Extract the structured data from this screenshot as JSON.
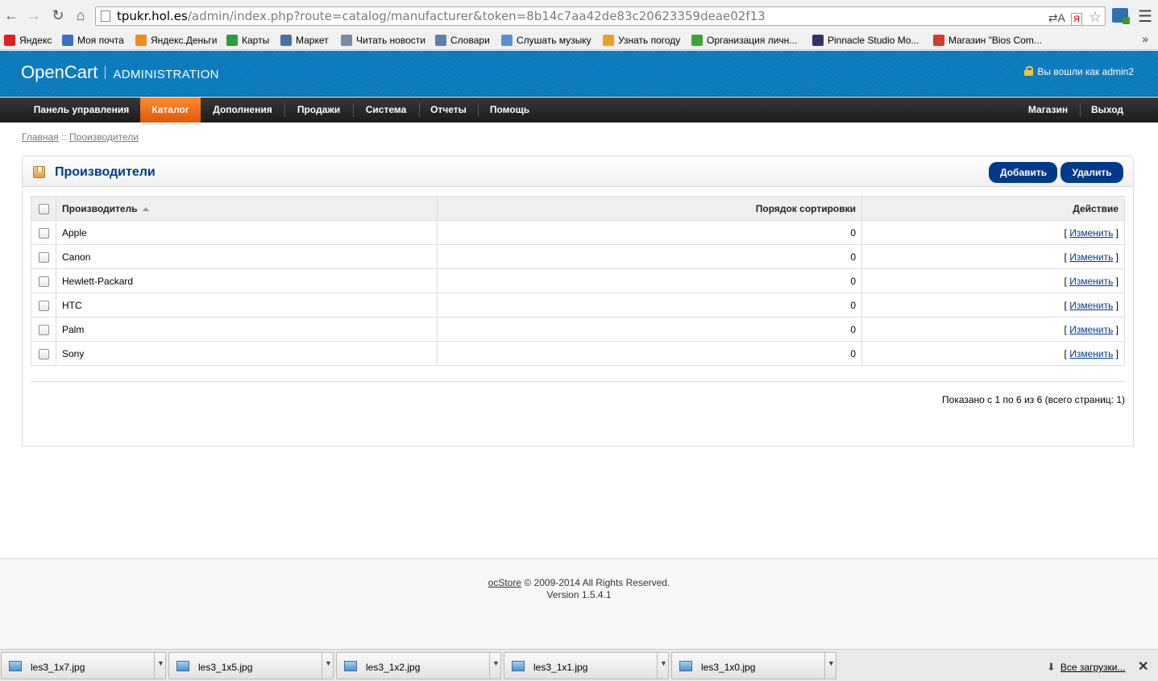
{
  "browser": {
    "url_host": "tpukr.hol.es",
    "url_path": "/admin/index.php?route=catalog/manufacturer&token=8b14c7aa42de83c20623359deae02f13",
    "omni_translate": "⇄A",
    "omni_yandex": "Я",
    "bookmarks": [
      {
        "label": "Яндекс",
        "icon": "yandex-icon",
        "color": "#e02020"
      },
      {
        "label": "Моя почта",
        "icon": "mail-icon",
        "color": "#3a6fc4"
      },
      {
        "label": "Яндекс.Деньги",
        "icon": "money-icon",
        "color": "#f28c1a"
      },
      {
        "label": "Карты",
        "icon": "maps-icon",
        "color": "#2e9d3a"
      },
      {
        "label": "Маркет",
        "icon": "market-icon",
        "color": "#4a6fa5"
      },
      {
        "label": "Читать новости",
        "icon": "news-icon",
        "color": "#7a8aa0"
      },
      {
        "label": "Словари",
        "icon": "dictionary-icon",
        "color": "#5c7fb0"
      },
      {
        "label": "Слушать музыку",
        "icon": "music-icon",
        "color": "#5a8fd0"
      },
      {
        "label": "Узнать погоду",
        "icon": "weather-icon",
        "color": "#f0a020"
      },
      {
        "label": "Организация личн...",
        "icon": "organizer-icon",
        "color": "#3aa53a"
      },
      {
        "label": "Pinnacle Studio Mo...",
        "icon": "pinnacle-icon",
        "color": "#333366"
      },
      {
        "label": "Магазин \"Bios Com...",
        "icon": "shop-icon",
        "color": "#d43a2a"
      }
    ],
    "bookmarks_more": "»"
  },
  "header": {
    "logo": "OpenCart",
    "subtitle": "ADMINISTRATION",
    "logged_in": "Вы вошли как admin2"
  },
  "menu": {
    "left": [
      {
        "label": "Панель управления"
      },
      {
        "label": "Каталог",
        "active": true
      },
      {
        "label": "Дополнения"
      },
      {
        "label": "Продажи"
      },
      {
        "label": "Система"
      },
      {
        "label": "Отчеты"
      },
      {
        "label": "Помощь"
      }
    ],
    "right": [
      {
        "label": "Магазин"
      },
      {
        "label": "Выход"
      }
    ],
    "active_color": "#e2570c"
  },
  "breadcrumb": {
    "home": "Главная",
    "separator": " :: ",
    "current": "Производители"
  },
  "panel": {
    "title": "Производители",
    "add_label": "Добавить",
    "delete_label": "Удалить",
    "button_color": "#003a88"
  },
  "table": {
    "headers": {
      "name": "Производитель",
      "sort_order": "Порядок сортировки",
      "action": "Действие"
    },
    "action_open": "[ ",
    "action_close": " ]",
    "rows": [
      {
        "name": "Apple",
        "sort_order": "0",
        "action": "Изменить"
      },
      {
        "name": "Canon",
        "sort_order": "0",
        "action": "Изменить"
      },
      {
        "name": "Hewlett-Packard",
        "sort_order": "0",
        "action": "Изменить"
      },
      {
        "name": "HTC",
        "sort_order": "0",
        "action": "Изменить"
      },
      {
        "name": "Palm",
        "sort_order": "0",
        "action": "Изменить"
      },
      {
        "name": "Sony",
        "sort_order": "0",
        "action": "Изменить"
      }
    ]
  },
  "pagination": {
    "results": "Показано с 1 по 6 из 6 (всего страниц: 1)"
  },
  "footer": {
    "link": "ocStore",
    "copyright": " © 2009-2014 All Rights Reserved.",
    "version": "Version 1.5.4.1"
  },
  "downloads": {
    "items": [
      {
        "name": "les3_1x7.jpg"
      },
      {
        "name": "les3_1x5.jpg"
      },
      {
        "name": "les3_1x2.jpg"
      },
      {
        "name": "les3_1x1.jpg"
      },
      {
        "name": "les3_1x0.jpg"
      }
    ],
    "all_label": "Все загрузки...",
    "close": "✕"
  }
}
